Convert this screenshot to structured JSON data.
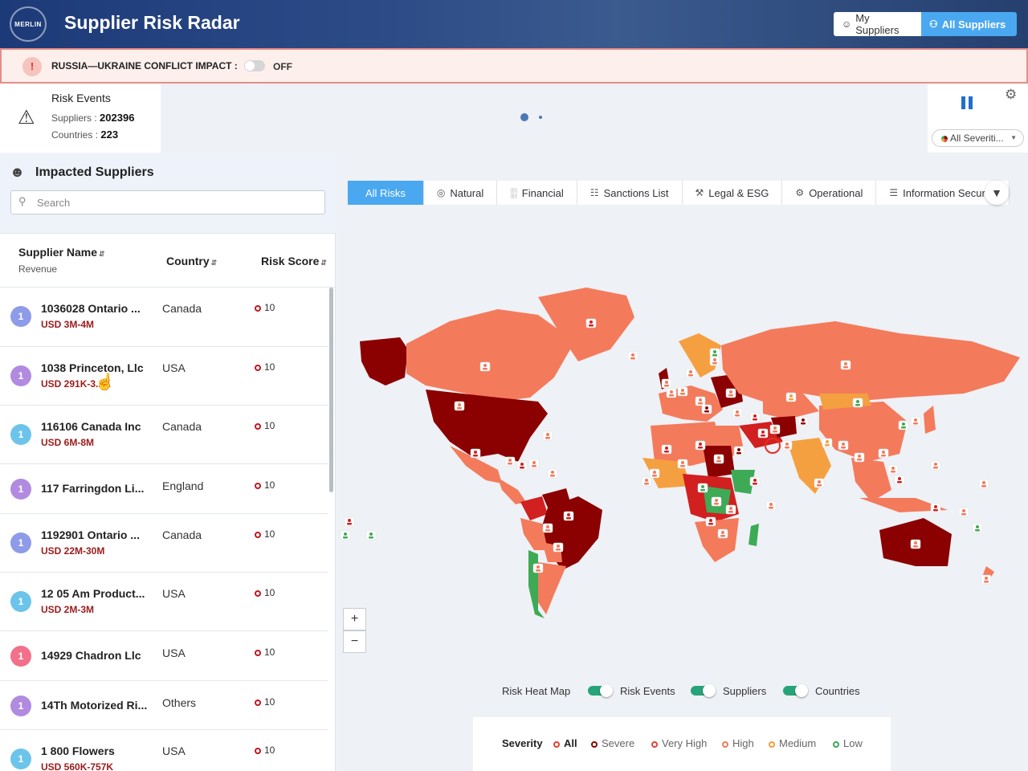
{
  "app": {
    "logo_text": "MERLIN",
    "title": "Supplier Risk Radar",
    "seg_my": "My Suppliers",
    "seg_all": "All Suppliers"
  },
  "banner": {
    "label": "RUSSIA—UKRAINE CONFLICT IMPACT :",
    "state": "OFF"
  },
  "risk_events": {
    "title": "Risk Events",
    "suppliers_label": "Suppliers :",
    "suppliers_value": "202396",
    "countries_label": "Countries :",
    "countries_value": "223"
  },
  "controls": {
    "severity_select": "All Severiti..."
  },
  "impacted": {
    "title": "Impacted Suppliers",
    "search_placeholder": "Search",
    "col_name": "Supplier Name",
    "col_name_sub": "Revenue",
    "col_country": "Country",
    "col_score": "Risk Score",
    "rows": [
      {
        "badge": "1",
        "name": "1036028 Ontario ...",
        "revenue": "USD 3M-4M",
        "country": "Canada",
        "score": "10",
        "color": "#8e9be8"
      },
      {
        "badge": "1",
        "name": "1038 Princeton, Llc",
        "revenue": "USD 291K-3...K",
        "country": "USA",
        "score": "10",
        "color": "#b18be0"
      },
      {
        "badge": "1",
        "name": "116106 Canada Inc",
        "revenue": "USD 6M-8M",
        "country": "Canada",
        "score": "10",
        "color": "#6cc4ea"
      },
      {
        "badge": "1",
        "name": "117 Farringdon Li...",
        "revenue": "",
        "country": "England",
        "score": "10",
        "color": "#b18be0"
      },
      {
        "badge": "1",
        "name": "1192901 Ontario ...",
        "revenue": "USD 22M-30M",
        "country": "Canada",
        "score": "10",
        "color": "#8e9be8"
      },
      {
        "badge": "1",
        "name": "12 05 Am Product...",
        "revenue": "USD 2M-3M",
        "country": "USA",
        "score": "10",
        "color": "#6cc4ea"
      },
      {
        "badge": "1",
        "name": "14929 Chadron Llc",
        "revenue": "",
        "country": "USA",
        "score": "10",
        "color": "#f2708a"
      },
      {
        "badge": "1",
        "name": "14Th Motorized Ri...",
        "revenue": "",
        "country": "Others",
        "score": "10",
        "color": "#b18be0"
      },
      {
        "badge": "1",
        "name": "1 800 Flowers",
        "revenue": "USD 560K-757K",
        "country": "USA",
        "score": "10",
        "color": "#6cc4ea"
      }
    ]
  },
  "tabs": [
    {
      "label": "All Risks",
      "icon": "all-risks-icon"
    },
    {
      "label": "Natural",
      "icon": "globe-icon"
    },
    {
      "label": "Financial",
      "icon": "bar-chart-icon"
    },
    {
      "label": "Sanctions List",
      "icon": "document-icon"
    },
    {
      "label": "Legal & ESG",
      "icon": "gavel-icon"
    },
    {
      "label": "Operational",
      "icon": "gear-icon"
    },
    {
      "label": "Information Security",
      "icon": "server-icon"
    }
  ],
  "map_toggles": {
    "heat_map": "Risk Heat Map",
    "risk_events": "Risk Events",
    "suppliers": "Suppliers",
    "countries": "Countries"
  },
  "severity_legend": {
    "label": "Severity",
    "items": [
      {
        "label": "All",
        "color": "#e8402f"
      },
      {
        "label": "Severe",
        "color": "#8b0000"
      },
      {
        "label": "Very High",
        "color": "#e8402f"
      },
      {
        "label": "High",
        "color": "#f07a5a"
      },
      {
        "label": "Medium",
        "color": "#f59c3b"
      },
      {
        "label": "Low",
        "color": "#3aa85a"
      }
    ]
  },
  "colors": {
    "accent": "#4aa8f0",
    "severe": "#8b0000",
    "very_high": "#d21f1f",
    "high": "#f47a5c",
    "medium": "#f5a040",
    "low": "#3faa56"
  }
}
